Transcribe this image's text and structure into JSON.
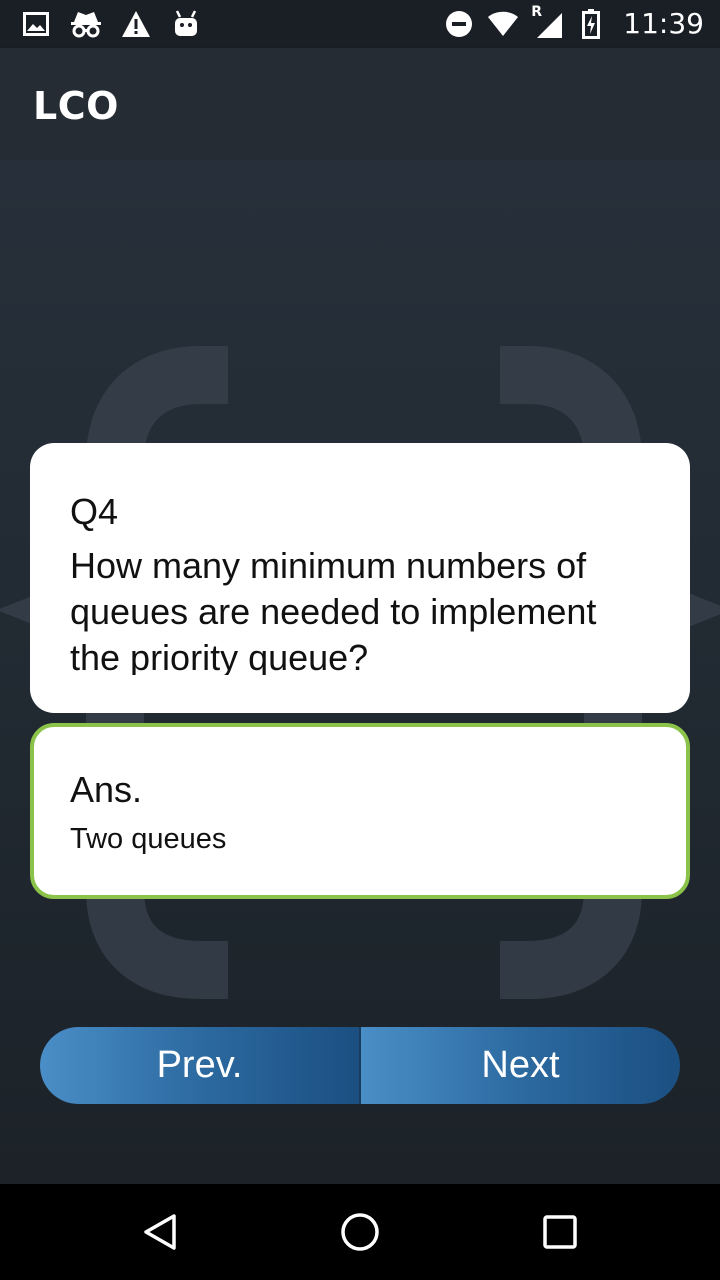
{
  "status_bar": {
    "time": "11:39",
    "icons_left": [
      "image-icon",
      "incognito-icon",
      "warning-icon",
      "android-icon"
    ],
    "icons_right": [
      "do-not-disturb-icon",
      "wifi-icon",
      "signal-roaming-icon",
      "battery-charging-icon"
    ],
    "roaming_indicator": "R"
  },
  "app_bar": {
    "title": "LCO"
  },
  "question": {
    "number": "Q4",
    "text": "How many minimum numbers of queues are needed to implement the priority queue?"
  },
  "answer": {
    "label": "Ans.",
    "text": "Two queues"
  },
  "navigation": {
    "prev_label": "Prev.",
    "next_label": "Next"
  },
  "system_nav": {
    "icons": [
      "back-icon",
      "home-icon",
      "recents-icon"
    ]
  },
  "colors": {
    "background": "#1f262d",
    "app_bar": "#252c34",
    "answer_border": "#8bc34a",
    "button_start": "#4a8ec7",
    "button_end": "#1b4f82"
  }
}
